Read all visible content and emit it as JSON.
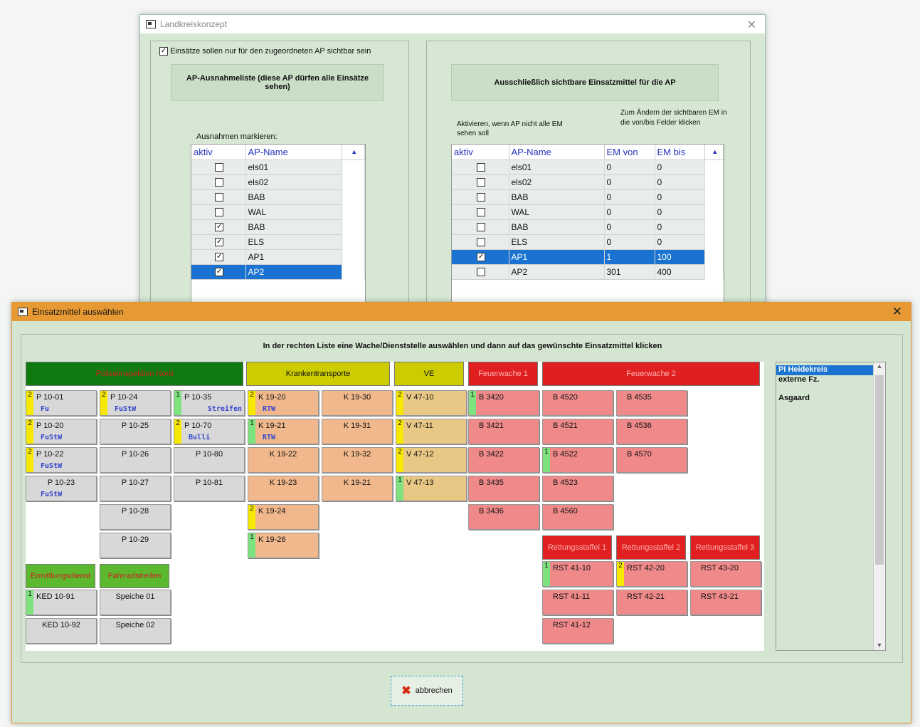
{
  "dialog1": {
    "title": "Landkreiskonzept",
    "checkbox_label": "Einsätze sollen nur für den zugeordneten AP sichtbar sein",
    "left_header": "AP-Ausnahmeliste (diese AP dürfen alle Einsätze sehen)",
    "left_caption": "Ausnahmen markieren:",
    "left_cols": [
      "aktiv",
      "AP-Name"
    ],
    "left_rows": [
      {
        "checked": false,
        "name": "els01"
      },
      {
        "checked": false,
        "name": "els02"
      },
      {
        "checked": false,
        "name": "BAB"
      },
      {
        "checked": false,
        "name": "WAL"
      },
      {
        "checked": true,
        "name": "BAB"
      },
      {
        "checked": true,
        "name": "ELS"
      },
      {
        "checked": true,
        "name": "AP1"
      },
      {
        "checked": true,
        "name": "AP2",
        "selected": true
      }
    ],
    "right_header": "Ausschließlich sichtbare Einsatzmittel für die AP",
    "right_caption1": "Aktivieren, wenn AP nicht alle EM sehen soll",
    "right_caption2": "Zum Ändern der sichtbaren EM in die von/bis Felder klicken",
    "right_cols": [
      "aktiv",
      "AP-Name",
      "EM von",
      "EM bis"
    ],
    "right_rows": [
      {
        "checked": false,
        "name": "els01",
        "von": "0",
        "bis": "0"
      },
      {
        "checked": false,
        "name": "els02",
        "von": "0",
        "bis": "0"
      },
      {
        "checked": false,
        "name": "BAB",
        "von": "0",
        "bis": "0"
      },
      {
        "checked": false,
        "name": "WAL",
        "von": "0",
        "bis": "0"
      },
      {
        "checked": false,
        "name": "BAB",
        "von": "0",
        "bis": "0"
      },
      {
        "checked": false,
        "name": "ELS",
        "von": "0",
        "bis": "0"
      },
      {
        "checked": true,
        "name": "AP1",
        "von": "1",
        "bis": "100",
        "selected": true
      },
      {
        "checked": false,
        "name": "AP2",
        "von": "301",
        "bis": "400"
      }
    ]
  },
  "dialog2": {
    "title": "Einsatzmittel auswählen",
    "instruction": "In der rechten Liste eine Wache/Dienststelle auswählen und dann auf das gewünschte Einsatzmittel klicken",
    "categories": [
      {
        "label": "Polizeiinspektion Nord",
        "color": "#0f7a0f"
      },
      {
        "label": "Krankentransporte",
        "color": "#cccc00"
      },
      {
        "label": "VE",
        "color": "#cccc00"
      },
      {
        "label": "Feuerwache 1",
        "color": "#e02020"
      },
      {
        "label": "Feuerwache 2",
        "color": "#e02020"
      },
      {
        "label": "Rettungsstaffel 1",
        "color": "#e02020"
      },
      {
        "label": "Rettungsstaffel 2",
        "color": "#e02020"
      },
      {
        "label": "Rettungsstaffel 3",
        "color": "#e02020"
      },
      {
        "label": "Ermittlungsdienst",
        "color": "#5cb82e"
      },
      {
        "label": "Fahrradstreifen",
        "color": "#5cb82e"
      }
    ],
    "units": [
      {
        "label": "P 10-01",
        "num": "2",
        "numc": "y",
        "sub": "Fu"
      },
      {
        "label": "P 10-24",
        "num": "2",
        "numc": "y",
        "sub": "FuStW"
      },
      {
        "label": "P 10-35",
        "num": "1",
        "numc": "g",
        "sub": "Streifen"
      },
      {
        "label": "P 10-20",
        "num": "2",
        "numc": "y",
        "sub": "FuStW"
      },
      {
        "label": "P 10-25"
      },
      {
        "label": "P 10-70",
        "num": "2",
        "numc": "y",
        "sub": "Bulli"
      },
      {
        "label": "P 10-22",
        "num": "2",
        "numc": "y",
        "sub": "FuStW"
      },
      {
        "label": "P 10-26"
      },
      {
        "label": "P 10-80"
      },
      {
        "label": "P 10-23",
        "sub": "FuStW"
      },
      {
        "label": "P 10-27"
      },
      {
        "label": "P 10-81"
      },
      {
        "label": "P 10-28"
      },
      {
        "label": "P 10-29"
      },
      {
        "label": "KED 10-91",
        "num": "1",
        "numc": "g"
      },
      {
        "label": "Speiche 01"
      },
      {
        "label": "KED 10-92"
      },
      {
        "label": "Speiche 02"
      },
      {
        "label": "K 19-20",
        "num": "2",
        "numc": "y",
        "sub": "RTW"
      },
      {
        "label": "K 19-30"
      },
      {
        "label": "K 19-21",
        "num": "1",
        "numc": "g",
        "sub": "RTW"
      },
      {
        "label": "K 19-31"
      },
      {
        "label": "K 19-22"
      },
      {
        "label": "K 19-32"
      },
      {
        "label": "K 19-23"
      },
      {
        "label": "K 19-21"
      },
      {
        "label": "K 19-24",
        "num": "2",
        "numc": "y"
      },
      {
        "label": "K 19-26",
        "num": "1",
        "numc": "g"
      },
      {
        "label": "V 47-10",
        "num": "2",
        "numc": "y"
      },
      {
        "label": "V 47-11",
        "num": "2",
        "numc": "y"
      },
      {
        "label": "V 47-12",
        "num": "2",
        "numc": "y"
      },
      {
        "label": "V 47-13",
        "num": "1",
        "numc": "g"
      },
      {
        "label": "B 3420",
        "num": "1",
        "numc": "g"
      },
      {
        "label": "B 3421"
      },
      {
        "label": "B 3422"
      },
      {
        "label": "B 3435"
      },
      {
        "label": "B 3436"
      },
      {
        "label": "B 4520"
      },
      {
        "label": "B 4535"
      },
      {
        "label": "B 4521"
      },
      {
        "label": "B 4536"
      },
      {
        "label": "B 4522",
        "num": "1",
        "numc": "g"
      },
      {
        "label": "B 4570"
      },
      {
        "label": "B 4523"
      },
      {
        "label": "B 4560"
      },
      {
        "label": "RST 41-10",
        "num": "1",
        "numc": "g"
      },
      {
        "label": "RST 42-20",
        "num": "2",
        "numc": "y"
      },
      {
        "label": "RST 43-20"
      },
      {
        "label": "RST 41-11"
      },
      {
        "label": "RST 42-21"
      },
      {
        "label": "RST 43-21"
      },
      {
        "label": "RST 41-12"
      }
    ],
    "side_list": [
      {
        "label": "PI Heidekreis",
        "selected": true
      },
      {
        "label": "externe Fz."
      },
      {
        "label": ""
      },
      {
        "label": "Asgaard"
      }
    ],
    "cancel_label": "abbrechen"
  }
}
